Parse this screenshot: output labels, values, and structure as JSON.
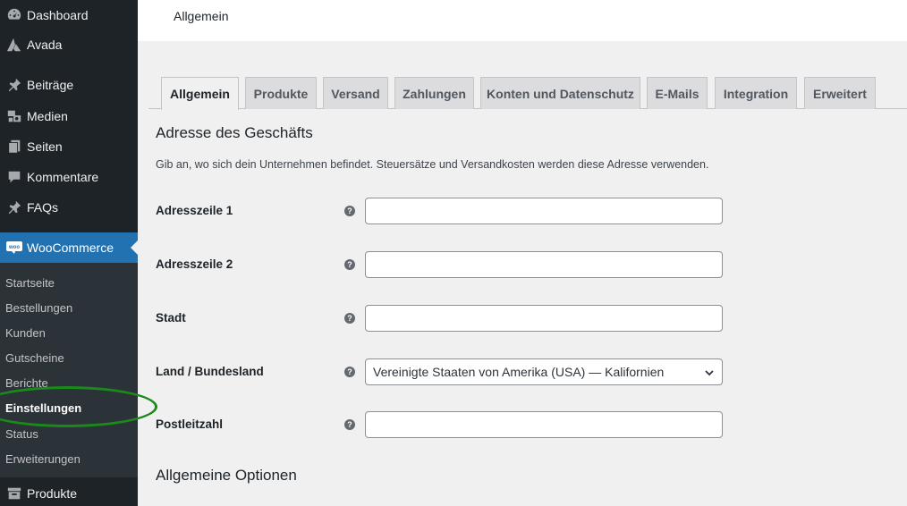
{
  "sidebar": {
    "items": [
      {
        "label": "Dashboard",
        "icon": "dashboard-icon"
      },
      {
        "label": "Avada",
        "icon": "avada-icon"
      },
      {
        "label": "Beiträge",
        "icon": "pushpin-icon"
      },
      {
        "label": "Medien",
        "icon": "media-icon"
      },
      {
        "label": "Seiten",
        "icon": "pages-icon"
      },
      {
        "label": "Kommentare",
        "icon": "comment-icon"
      },
      {
        "label": "FAQs",
        "icon": "pushpin-icon"
      },
      {
        "label": "WooCommerce",
        "icon": "woocommerce-icon"
      },
      {
        "label": "Produkte",
        "icon": "archive-icon"
      }
    ],
    "submenu": [
      "Startseite",
      "Bestellungen",
      "Kunden",
      "Gutscheine",
      "Berichte",
      "Einstellungen",
      "Status",
      "Erweiterungen"
    ],
    "submenu_current": "Einstellungen",
    "active_color": "#2271b1",
    "highlight_ring_color": "#1a8a1a"
  },
  "header": {
    "title": "Allgemein"
  },
  "tabs": [
    "Allgemein",
    "Produkte",
    "Versand",
    "Zahlungen",
    "Konten und Datenschutz",
    "E-Mails",
    "Integration",
    "Erweitert"
  ],
  "active_tab": "Allgemein",
  "section": {
    "title": "Adresse des Geschäfts",
    "description": "Gib an, wo sich dein Unternehmen befindet. Steuersätze und Versandkosten werden diese Adresse verwenden.",
    "fields": [
      {
        "label": "Adresszeile 1",
        "value": "",
        "type": "text"
      },
      {
        "label": "Adresszeile 2",
        "value": "",
        "type": "text"
      },
      {
        "label": "Stadt",
        "value": "",
        "type": "text"
      },
      {
        "label": "Land / Bundesland",
        "value": "Vereinigte Staaten von Amerika (USA) — Kalifornien",
        "type": "select"
      },
      {
        "label": "Postleitzahl",
        "value": "",
        "type": "text"
      }
    ],
    "help_icon_glyph": "?"
  },
  "section2": {
    "title": "Allgemeine Optionen"
  }
}
